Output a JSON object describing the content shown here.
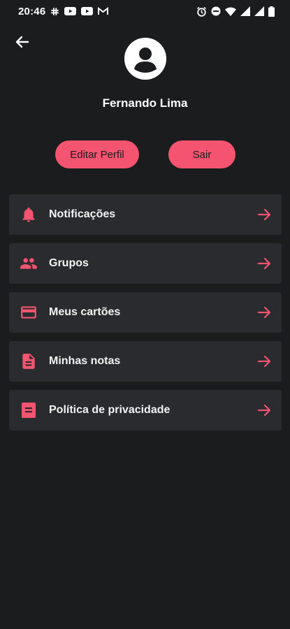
{
  "colors": {
    "background": "#1b1c1e",
    "card": "#2a2b2e",
    "accent": "#f4546f",
    "text": "#ffffff"
  },
  "status_bar": {
    "time": "20:46",
    "left_icons": [
      "slack-icon",
      "youtube-icon",
      "youtube-icon",
      "gmail-icon"
    ],
    "right_icons": [
      "alarm-icon",
      "do-not-disturb-icon",
      "wifi-icon",
      "signal-icon",
      "signal-icon",
      "battery-icon"
    ]
  },
  "header": {
    "back_icon": "arrow-left-icon",
    "avatar_icon": "account-circle-icon"
  },
  "profile": {
    "name": "Fernando Lima",
    "edit_label": "Editar Perfil",
    "logout_label": "Sair"
  },
  "menu": {
    "items": [
      {
        "label": "Notificações",
        "icon": "bell-icon"
      },
      {
        "label": "Grupos",
        "icon": "group-icon"
      },
      {
        "label": "Meus cartões",
        "icon": "credit-card-icon"
      },
      {
        "label": "Minhas notas",
        "icon": "document-icon"
      },
      {
        "label": "Política de privacidade",
        "icon": "policy-icon"
      }
    ],
    "arrow_icon": "arrow-right-icon"
  }
}
